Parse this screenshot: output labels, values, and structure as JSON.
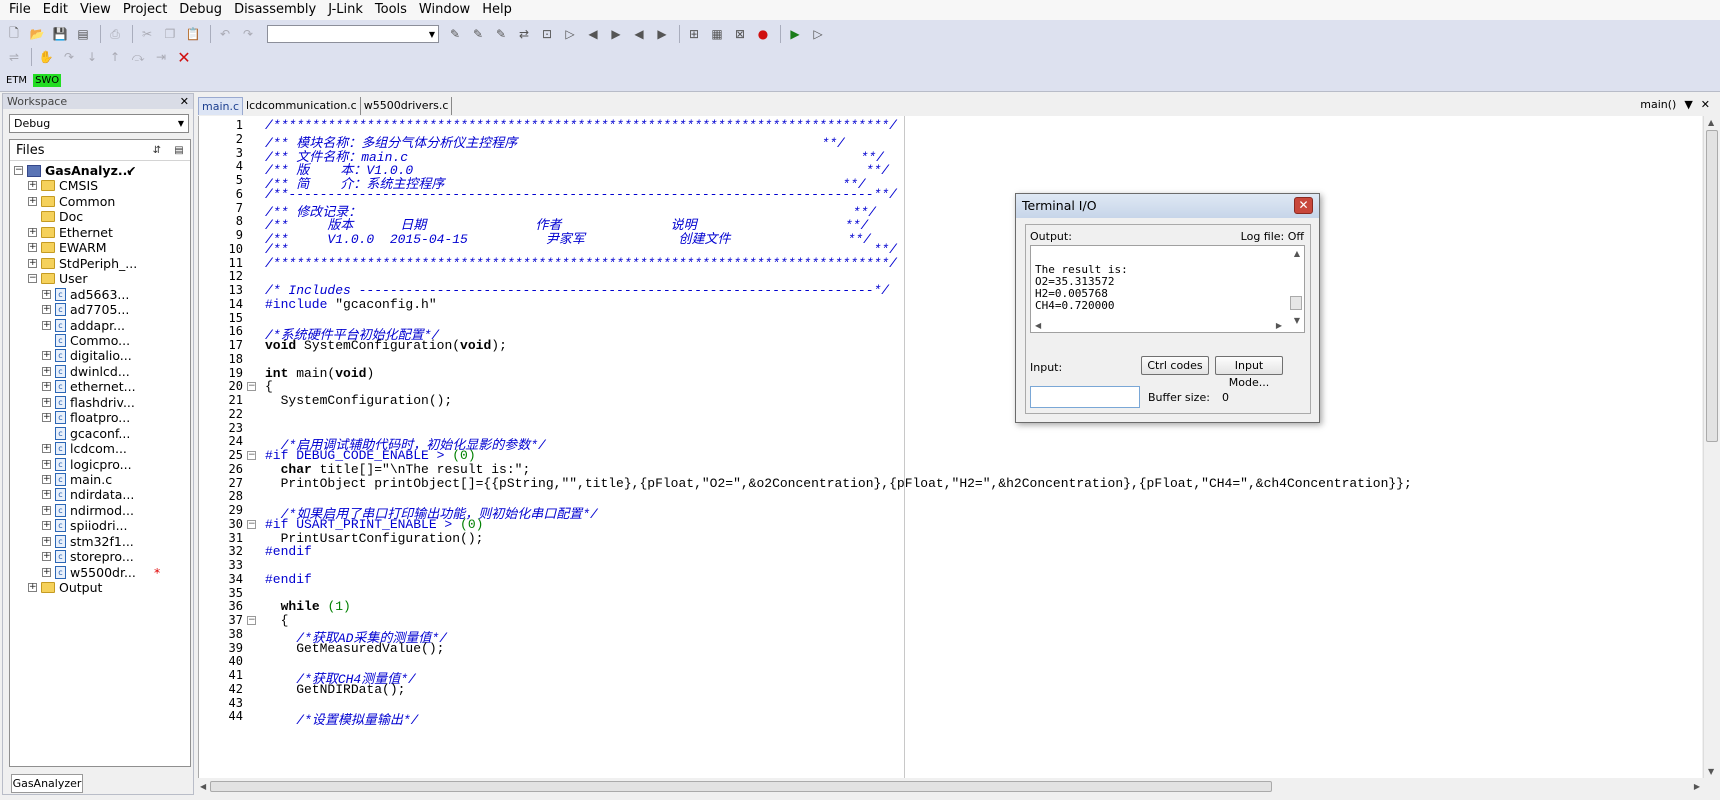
{
  "menu": [
    "File",
    "Edit",
    "View",
    "Project",
    "Debug",
    "Disassembly",
    "J-Link",
    "Tools",
    "Window",
    "Help"
  ],
  "toolbar": {
    "config_value": "",
    "etm_label": "ETM",
    "swo_label": "SWO"
  },
  "workspace": {
    "title": "Workspace",
    "config": "Debug",
    "files_header": "Files",
    "bottom_tab": "GasAnalyzer",
    "tree": [
      {
        "label": "GasAnalyz...",
        "type": "project",
        "level": 0,
        "check": "✔"
      },
      {
        "label": "CMSIS",
        "type": "folder",
        "level": 1,
        "expand": "+"
      },
      {
        "label": "Common",
        "type": "folder",
        "level": 1,
        "expand": "+"
      },
      {
        "label": "Doc",
        "type": "folder",
        "level": 1,
        "expand": ""
      },
      {
        "label": "Ethernet",
        "type": "folder",
        "level": 1,
        "expand": "+"
      },
      {
        "label": "EWARM",
        "type": "folder",
        "level": 1,
        "expand": "+"
      },
      {
        "label": "StdPeriph_...",
        "type": "folder",
        "level": 1,
        "expand": "+"
      },
      {
        "label": "User",
        "type": "folder",
        "level": 1,
        "expand": "−"
      },
      {
        "label": "ad5663...",
        "type": "file",
        "level": 2,
        "expand": "+"
      },
      {
        "label": "ad7705...",
        "type": "file",
        "level": 2,
        "expand": "+"
      },
      {
        "label": "addapr...",
        "type": "file",
        "level": 2,
        "expand": "+"
      },
      {
        "label": "Commo...",
        "type": "file",
        "level": 2,
        "expand": ""
      },
      {
        "label": "digitalio...",
        "type": "file",
        "level": 2,
        "expand": "+"
      },
      {
        "label": "dwinlcd...",
        "type": "file",
        "level": 2,
        "expand": "+"
      },
      {
        "label": "ethernet...",
        "type": "file",
        "level": 2,
        "expand": "+"
      },
      {
        "label": "flashdriv...",
        "type": "file",
        "level": 2,
        "expand": "+"
      },
      {
        "label": "floatpro...",
        "type": "file",
        "level": 2,
        "expand": "+"
      },
      {
        "label": "gcaconf...",
        "type": "file",
        "level": 2,
        "expand": ""
      },
      {
        "label": "lcdcom...",
        "type": "file",
        "level": 2,
        "expand": "+"
      },
      {
        "label": "logicpro...",
        "type": "file",
        "level": 2,
        "expand": "+"
      },
      {
        "label": "main.c",
        "type": "file",
        "level": 2,
        "expand": "+"
      },
      {
        "label": "ndirdata...",
        "type": "file",
        "level": 2,
        "expand": "+"
      },
      {
        "label": "ndirmod...",
        "type": "file",
        "level": 2,
        "expand": "+"
      },
      {
        "label": "spiiodri...",
        "type": "file",
        "level": 2,
        "expand": "+"
      },
      {
        "label": "stm32f1...",
        "type": "file",
        "level": 2,
        "expand": "+"
      },
      {
        "label": "storepro...",
        "type": "file",
        "level": 2,
        "expand": "+"
      },
      {
        "label": "w5500dr...",
        "type": "file",
        "level": 2,
        "expand": "+",
        "mark": "*"
      },
      {
        "label": "Output",
        "type": "folder",
        "level": 1,
        "expand": "+"
      }
    ]
  },
  "editor": {
    "tabs": [
      {
        "label": "main.c",
        "active": true
      },
      {
        "label": "lcdcommunication.c",
        "active": false
      },
      {
        "label": "w5500drivers.c",
        "active": false
      }
    ],
    "function_dropdown": "main()",
    "lines": [
      {
        "n": "1",
        "segs": [
          {
            "c": "cm",
            "t": "/*******************************************************************************/"
          }
        ]
      },
      {
        "n": "2",
        "segs": [
          {
            "c": "cm",
            "t": "/** 模块名称：多组分气体分析仪主控程序                                       **/"
          }
        ]
      },
      {
        "n": "3",
        "segs": [
          {
            "c": "cm",
            "t": "/** 文件名称：main.c                                                          **/"
          }
        ]
      },
      {
        "n": "4",
        "segs": [
          {
            "c": "cm",
            "t": "/** 版    本：V1.0.0                                                          **/"
          }
        ]
      },
      {
        "n": "5",
        "segs": [
          {
            "c": "cm",
            "t": "/** 简    介：系统主控程序                                                   **/"
          }
        ]
      },
      {
        "n": "6",
        "segs": [
          {
            "c": "cm",
            "t": "/**---------------------------------------------------------------------------**/"
          }
        ]
      },
      {
        "n": "7",
        "segs": [
          {
            "c": "cm",
            "t": "/** 修改记录：                                                               **/"
          }
        ]
      },
      {
        "n": "8",
        "segs": [
          {
            "c": "cm",
            "t": "/**     版本      日期              作者              说明                   **/"
          }
        ]
      },
      {
        "n": "9",
        "segs": [
          {
            "c": "cm",
            "t": "/**     V1.0.0  2015-04-15          尹家军            创建文件               **/"
          }
        ]
      },
      {
        "n": "10",
        "segs": [
          {
            "c": "cm",
            "t": "/**                                                                           **/"
          }
        ]
      },
      {
        "n": "11",
        "segs": [
          {
            "c": "cm",
            "t": "/*******************************************************************************/"
          }
        ]
      },
      {
        "n": "12",
        "segs": []
      },
      {
        "n": "13",
        "segs": [
          {
            "c": "cm",
            "t": "/* Includes ------------------------------------------------------------------*/"
          }
        ]
      },
      {
        "n": "14",
        "segs": [
          {
            "c": "pp",
            "t": "#include"
          },
          {
            "c": "",
            "t": " \"gcaconfig.h\""
          }
        ]
      },
      {
        "n": "15",
        "segs": []
      },
      {
        "n": "16",
        "segs": [
          {
            "c": "cm",
            "t": "/*系统硬件平台初始化配置*/"
          }
        ]
      },
      {
        "n": "17",
        "segs": [
          {
            "c": "kw",
            "t": "void"
          },
          {
            "c": "",
            "t": " SystemConfiguration("
          },
          {
            "c": "kw",
            "t": "void"
          },
          {
            "c": "",
            "t": ");"
          }
        ]
      },
      {
        "n": "18",
        "segs": []
      },
      {
        "n": "19",
        "segs": [
          {
            "c": "kw",
            "t": "int"
          },
          {
            "c": "",
            "t": " main("
          },
          {
            "c": "kw",
            "t": "void"
          },
          {
            "c": "",
            "t": ")"
          }
        ]
      },
      {
        "n": "20",
        "fold": "−",
        "segs": [
          {
            "c": "",
            "t": "{"
          }
        ]
      },
      {
        "n": "21",
        "segs": [
          {
            "c": "",
            "t": "  SystemConfiguration();"
          }
        ]
      },
      {
        "n": "22",
        "segs": []
      },
      {
        "n": "23",
        "segs": []
      },
      {
        "n": "24",
        "segs": [
          {
            "c": "",
            "t": "  "
          },
          {
            "c": "cm",
            "t": "/*启用调试辅助代码时，初始化显影的参数*/"
          }
        ]
      },
      {
        "n": "25",
        "fold": "−",
        "segs": [
          {
            "c": "pp",
            "t": "#if DEBUG_CODE_ENABLE > "
          },
          {
            "c": "num",
            "t": "(0)"
          }
        ]
      },
      {
        "n": "26",
        "segs": [
          {
            "c": "",
            "t": "  "
          },
          {
            "c": "kw",
            "t": "char"
          },
          {
            "c": "",
            "t": " title[]=\"\\nThe result is:\";"
          }
        ]
      },
      {
        "n": "27",
        "segs": [
          {
            "c": "",
            "t": "  PrintObject printObject[]={{pString,\"\",title},{pFloat,\"O2=\",&o2Concentration},{pFloat,\"H2=\",&h2Concentration},{pFloat,\"CH4=\",&ch4Concentration}};"
          }
        ]
      },
      {
        "n": "28",
        "segs": []
      },
      {
        "n": "29",
        "segs": [
          {
            "c": "",
            "t": "  "
          },
          {
            "c": "cm",
            "t": "/*如果启用了串口打印输出功能，则初始化串口配置*/"
          }
        ]
      },
      {
        "n": "30",
        "fold": "−",
        "segs": [
          {
            "c": "pp",
            "t": "#if USART_PRINT_ENABLE > "
          },
          {
            "c": "num",
            "t": "(0)"
          }
        ]
      },
      {
        "n": "31",
        "segs": [
          {
            "c": "",
            "t": "  PrintUsartConfiguration();"
          }
        ]
      },
      {
        "n": "32",
        "segs": [
          {
            "c": "pp",
            "t": "#endif"
          }
        ]
      },
      {
        "n": "33",
        "segs": []
      },
      {
        "n": "34",
        "segs": [
          {
            "c": "pp",
            "t": "#endif"
          }
        ]
      },
      {
        "n": "35",
        "segs": []
      },
      {
        "n": "36",
        "segs": [
          {
            "c": "",
            "t": "  "
          },
          {
            "c": "kw",
            "t": "while"
          },
          {
            "c": "",
            "t": " "
          },
          {
            "c": "num",
            "t": "(1)"
          }
        ]
      },
      {
        "n": "37",
        "fold": "−",
        "segs": [
          {
            "c": "",
            "t": "  {"
          }
        ]
      },
      {
        "n": "38",
        "segs": [
          {
            "c": "",
            "t": "    "
          },
          {
            "c": "cm",
            "t": "/*获取AD采集的测量值*/"
          }
        ]
      },
      {
        "n": "39",
        "segs": [
          {
            "c": "",
            "t": "    GetMeasuredValue();"
          }
        ]
      },
      {
        "n": "40",
        "segs": []
      },
      {
        "n": "41",
        "segs": [
          {
            "c": "",
            "t": "    "
          },
          {
            "c": "cm",
            "t": "/*获取CH4测量值*/"
          }
        ]
      },
      {
        "n": "42",
        "segs": [
          {
            "c": "",
            "t": "    GetNDIRData();"
          }
        ]
      },
      {
        "n": "43",
        "segs": []
      },
      {
        "n": "44",
        "segs": [
          {
            "c": "",
            "t": "    "
          },
          {
            "c": "cm",
            "t": "/*设置模拟量输出*/"
          }
        ]
      }
    ]
  },
  "terminal": {
    "title": "Terminal I/O",
    "output_label": "Output:",
    "log_file_label": "Log file: Off",
    "output_lines": [
      "",
      "The result is:",
      "O2=35.313572",
      "H2=0.005768",
      "CH4=0.720000"
    ],
    "input_label": "Input:",
    "input_value": "",
    "ctrl_codes_label": "Ctrl codes",
    "input_mode_label": "Input Mode...",
    "buffer_size_label": "Buffer size:",
    "buffer_size_value": "0"
  }
}
